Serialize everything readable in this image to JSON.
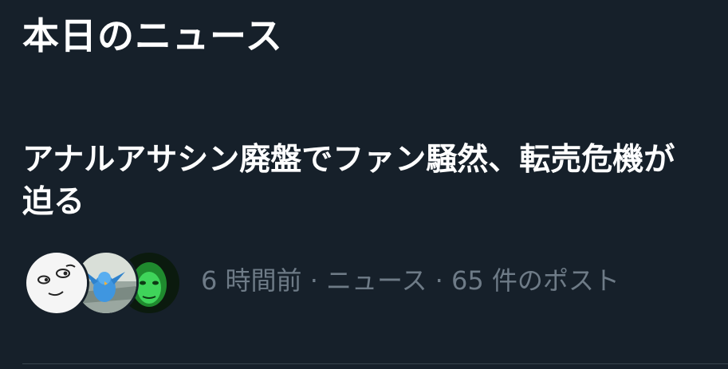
{
  "section": {
    "title": "本日のニュース"
  },
  "news_item": {
    "headline": "アナルアサシン廃盤でファン騒然、転売危機が迫る",
    "meta": "6 時間前 · ニュース · 65 件のポスト",
    "avatars": [
      "avatar-smiley-icon",
      "avatar-bird-icon",
      "avatar-face-icon"
    ]
  },
  "colors": {
    "background": "#16202a",
    "primary_text": "#ffffff",
    "secondary_text": "#6e7b87",
    "divider": "#38444d"
  }
}
